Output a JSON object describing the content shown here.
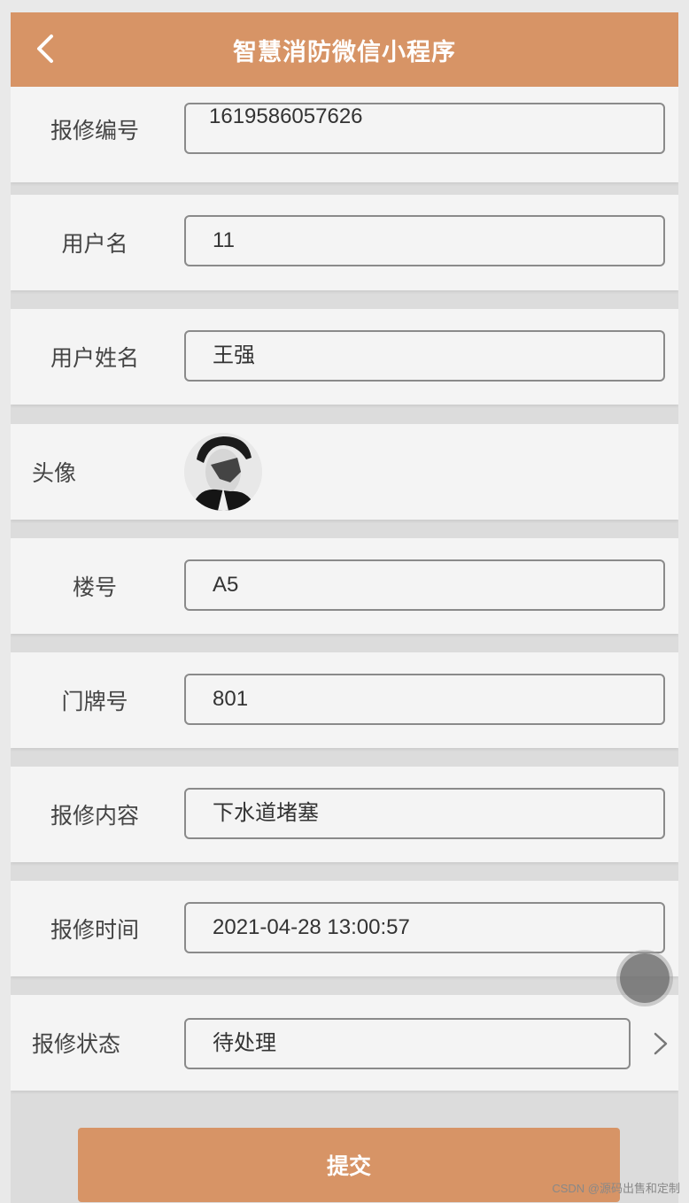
{
  "header": {
    "title": "智慧消防微信小程序"
  },
  "form": {
    "repair_no": {
      "label": "报修编号",
      "value": "1619586057626"
    },
    "username": {
      "label": "用户名",
      "value": "11"
    },
    "real_name": {
      "label": "用户姓名",
      "value": "王强"
    },
    "avatar": {
      "label": "头像"
    },
    "building": {
      "label": "楼号",
      "value": "A5"
    },
    "door_no": {
      "label": "门牌号",
      "value": "801"
    },
    "content": {
      "label": "报修内容",
      "value": "下水道堵塞"
    },
    "time": {
      "label": "报修时间",
      "value": "2021-04-28 13:00:57"
    },
    "status": {
      "label": "报修状态",
      "value": "待处理"
    }
  },
  "submit_label": "提交",
  "watermark": "CSDN @源码出售和定制",
  "colors": {
    "accent": "#d79466",
    "background": "#f4f4f4"
  },
  "icons": {
    "back": "chevron-left-icon",
    "status_select": "chevron-right-icon"
  }
}
